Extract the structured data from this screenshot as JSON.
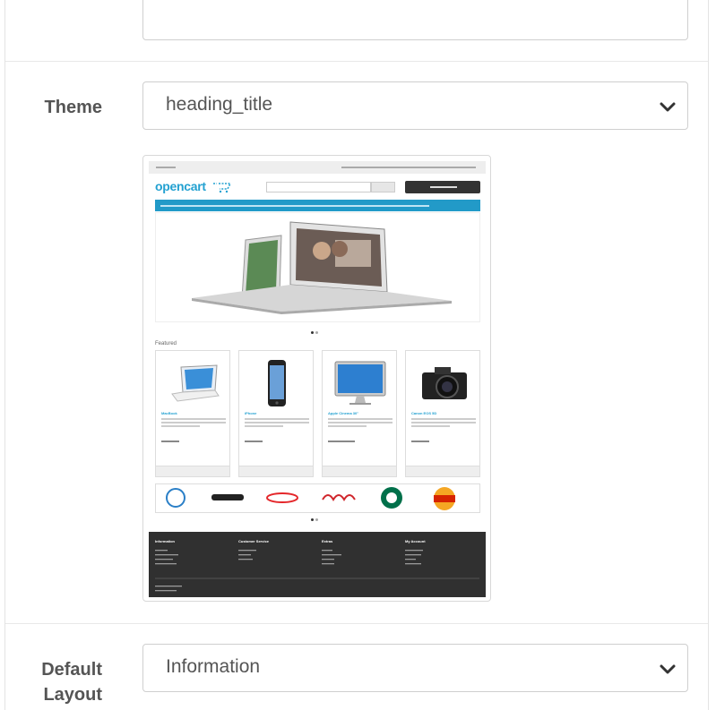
{
  "form": {
    "theme": {
      "label": "Theme",
      "value": "heading_title"
    },
    "default_layout": {
      "label": "Default Layout",
      "value": "Information"
    }
  },
  "preview": {
    "logo": "opencart",
    "featured_label": "Featured",
    "products": [
      {
        "name": "MacBook"
      },
      {
        "name": "iPhone"
      },
      {
        "name": "Apple Cinema 30\""
      },
      {
        "name": "Canon EOS 5D"
      }
    ],
    "footer_headings": [
      "Information",
      "Customer Service",
      "Extras",
      "My Account"
    ],
    "brands": [
      "dell-logo",
      "disney-logo",
      "nintendo-logo",
      "coca-cola-logo",
      "starbucks-logo",
      "burger-king-logo"
    ],
    "colors": {
      "brand_blue": "#23a1d1",
      "menu_blue": "#229ac8",
      "footer": "#303030"
    }
  }
}
